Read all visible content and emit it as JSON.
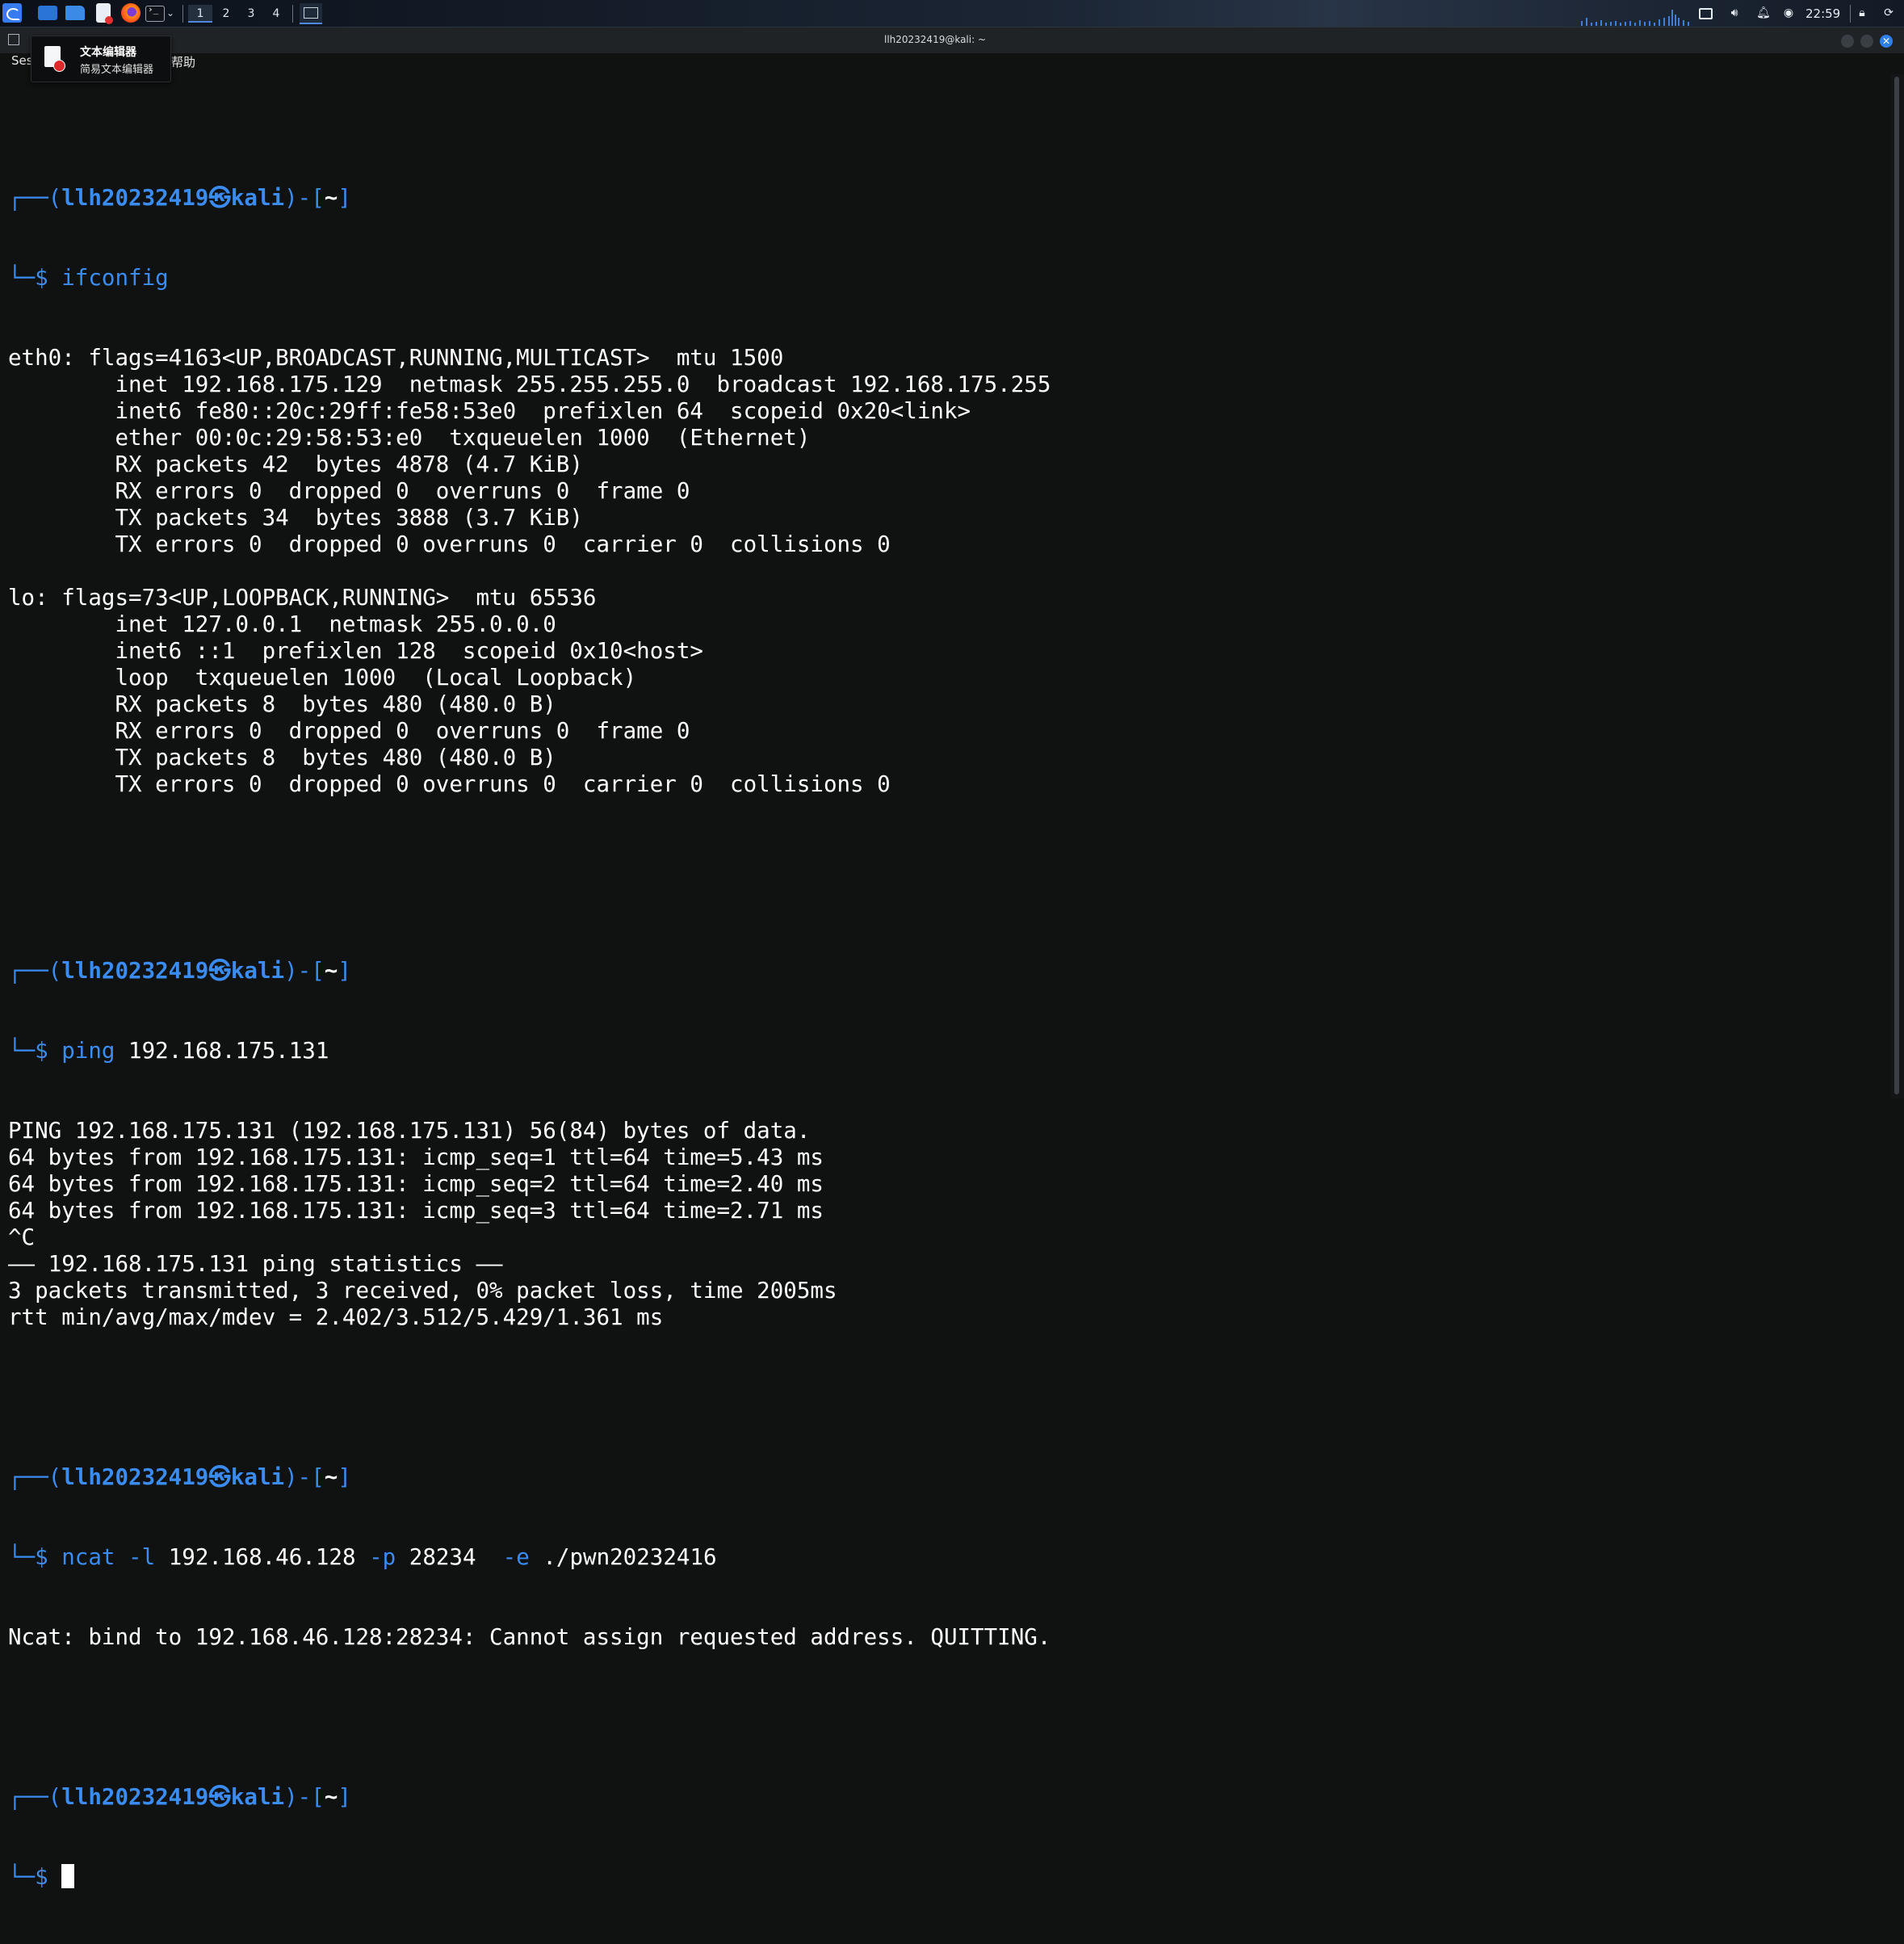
{
  "taskbar": {
    "workspaces": [
      "1",
      "2",
      "3",
      "4"
    ],
    "clock": "22:59",
    "icons": [
      "kali-menu-icon",
      "show-desktop-icon",
      "file-manager-icon",
      "text-editor-icon",
      "firefox-icon",
      "terminal-icon",
      "volume-icon",
      "notification-bell-icon",
      "power-icon",
      "lock-icon",
      "logout-icon"
    ]
  },
  "window": {
    "title": "llh20232419@kali: ~",
    "close_glyph": "✕"
  },
  "menubar": {
    "session_label": "Ses",
    "help_label": "帮助"
  },
  "tooltip": {
    "title": "文本编辑器",
    "subtitle": "简易文本编辑器"
  },
  "prompt": {
    "open": "┌──(",
    "user": "llh20232419",
    "at": "㉿",
    "host": "kali",
    "close": ")-[",
    "cwd": "~",
    "end": "]",
    "corner": "└─",
    "dollar": "$"
  },
  "terminal": {
    "cmd1": {
      "name": "ifconfig",
      "args": ""
    },
    "ifconfig_output": [
      "eth0: flags=4163<UP,BROADCAST,RUNNING,MULTICAST>  mtu 1500",
      "        inet 192.168.175.129  netmask 255.255.255.0  broadcast 192.168.175.255",
      "        inet6 fe80::20c:29ff:fe58:53e0  prefixlen 64  scopeid 0x20<link>",
      "        ether 00:0c:29:58:53:e0  txqueuelen 1000  (Ethernet)",
      "        RX packets 42  bytes 4878 (4.7 KiB)",
      "        RX errors 0  dropped 0  overruns 0  frame 0",
      "        TX packets 34  bytes 3888 (3.7 KiB)",
      "        TX errors 0  dropped 0 overruns 0  carrier 0  collisions 0",
      "",
      "lo: flags=73<UP,LOOPBACK,RUNNING>  mtu 65536",
      "        inet 127.0.0.1  netmask 255.0.0.0",
      "        inet6 ::1  prefixlen 128  scopeid 0x10<host>",
      "        loop  txqueuelen 1000  (Local Loopback)",
      "        RX packets 8  bytes 480 (480.0 B)",
      "        RX errors 0  dropped 0  overruns 0  frame 0",
      "        TX packets 8  bytes 480 (480.0 B)",
      "        TX errors 0  dropped 0 overruns 0  carrier 0  collisions 0",
      "",
      ""
    ],
    "cmd2": {
      "name": "ping",
      "args": " 192.168.175.131"
    },
    "ping_output": [
      "PING 192.168.175.131 (192.168.175.131) 56(84) bytes of data.",
      "64 bytes from 192.168.175.131: icmp_seq=1 ttl=64 time=5.43 ms",
      "64 bytes from 192.168.175.131: icmp_seq=2 ttl=64 time=2.40 ms",
      "64 bytes from 192.168.175.131: icmp_seq=3 ttl=64 time=2.71 ms",
      "^C",
      "—— 192.168.175.131 ping statistics ——",
      "3 packets transmitted, 3 received, 0% packet loss, time 2005ms",
      "rtt min/avg/max/mdev = 2.402/3.512/5.429/1.361 ms",
      ""
    ],
    "cmd3": {
      "name": "ncat",
      "parts": [
        {
          "t": " ",
          "c": "plain"
        },
        {
          "t": "-l",
          "c": "opt"
        },
        {
          "t": " 192.168.46.128 ",
          "c": "plain"
        },
        {
          "t": "-p",
          "c": "opt"
        },
        {
          "t": " 28234  ",
          "c": "plain"
        },
        {
          "t": "-e",
          "c": "opt"
        },
        {
          "t": " ./pwn20232416",
          "c": "plain"
        }
      ]
    },
    "ncat_output": [
      "Ncat: bind to 192.168.46.128:28234: Cannot assign requested address. QUITTING.",
      ""
    ]
  }
}
